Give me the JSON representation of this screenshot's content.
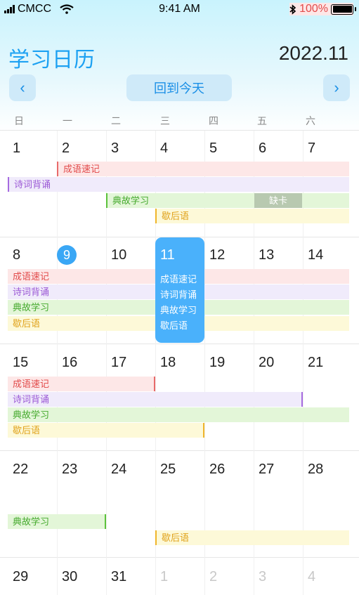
{
  "status_bar": {
    "carrier": "CMCC",
    "time": "9:41 AM",
    "battery": "100%"
  },
  "header": {
    "title": "学习日历",
    "month": "2022.11",
    "prev_label": "‹",
    "next_label": "›",
    "today_label": "回到今天"
  },
  "weekdays": [
    "日",
    "一",
    "二",
    "三",
    "四",
    "五",
    "六"
  ],
  "days": {
    "w1": [
      "1",
      "2",
      "3",
      "4",
      "5",
      "6",
      "7"
    ],
    "w2": [
      "8",
      "9",
      "10",
      "11",
      "12",
      "13",
      "14"
    ],
    "w3": [
      "15",
      "16",
      "17",
      "18",
      "19",
      "20",
      "21"
    ],
    "w4": [
      "22",
      "23",
      "24",
      "25",
      "26",
      "27",
      "28"
    ],
    "w5": [
      "29",
      "30",
      "31",
      "1",
      "2",
      "3",
      "4"
    ]
  },
  "tasks": {
    "idioms": "成语速记",
    "poems": "诗词背诵",
    "allusions": "典故学习",
    "xiehouyu": "歇后语"
  },
  "missed_label": "缺卡",
  "colors": {
    "accent": "#1da1f2",
    "idioms": "#e24b4b",
    "poems": "#9b59d6",
    "allusions": "#44a92c",
    "xiehouyu": "#e0a21a"
  }
}
